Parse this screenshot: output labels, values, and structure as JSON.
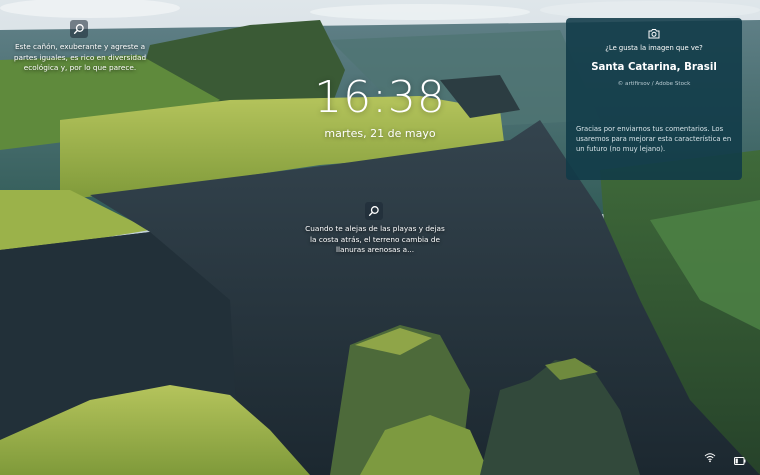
{
  "lock_screen": {
    "time": "16:38",
    "date": "martes, 21 de mayo"
  },
  "hotspots": [
    {
      "icon": "search-icon",
      "lines": [
        "Este cañón, exuberante y agreste a",
        "partes iguales, es rico en diversidad",
        "ecológica y, por lo que parece."
      ]
    },
    {
      "icon": "search-icon",
      "lines": [
        "Cuando te alejas de las playas y dejas",
        "la costa atrás, el terreno cambia de",
        "llanuras arenosas a..."
      ]
    }
  ],
  "image_info": {
    "camera_icon": "camera-icon",
    "question": "¿Le gusta la imagen que ve?",
    "location": "Santa Catarina, Brasil",
    "credit": "© artifirsov / Adobe Stock",
    "thanks": "Gracias por enviarnos tus comentarios. Los usaremos para mejorar esta característica en un futuro (no muy lejano)."
  },
  "system_tray": {
    "network_icon": "wifi-icon",
    "battery_icon": "battery-icon",
    "battery_level": 0.3
  },
  "colors": {
    "sky": "#c9d8e0",
    "grass": "#9db14a",
    "cliff": "#2a3a44",
    "panel": "#103a48"
  }
}
